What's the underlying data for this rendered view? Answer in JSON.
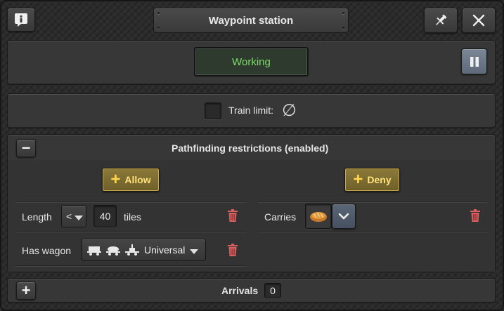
{
  "window": {
    "title": "Waypoint station",
    "info_icon": "info-icon",
    "pin_icon": "pin-icon",
    "close_icon": "close-icon"
  },
  "status": {
    "text": "Working",
    "color": "#7ddc6a",
    "pause_icon": "pause-icon"
  },
  "train_limit": {
    "label": "Train limit:",
    "checked": false,
    "value_symbol": "∅"
  },
  "pathfinding": {
    "collapse_symbol": "−",
    "title": "Pathfinding restrictions (enabled)",
    "allow": {
      "label": "Allow",
      "rules": [
        {
          "label": "Length",
          "operator": "<",
          "value": "40",
          "unit": "tiles"
        },
        {
          "label": "Has wagon",
          "wagon_icons": [
            "cargo-wagon-icon",
            "fluid-wagon-icon",
            "artillery-wagon-icon"
          ],
          "selection": "Universal"
        }
      ]
    },
    "deny": {
      "label": "Deny",
      "rules": [
        {
          "label": "Carries",
          "item_icon": "bread-icon"
        }
      ]
    }
  },
  "arrivals": {
    "expand_symbol": "+",
    "label": "Arrivals",
    "count": "0"
  }
}
